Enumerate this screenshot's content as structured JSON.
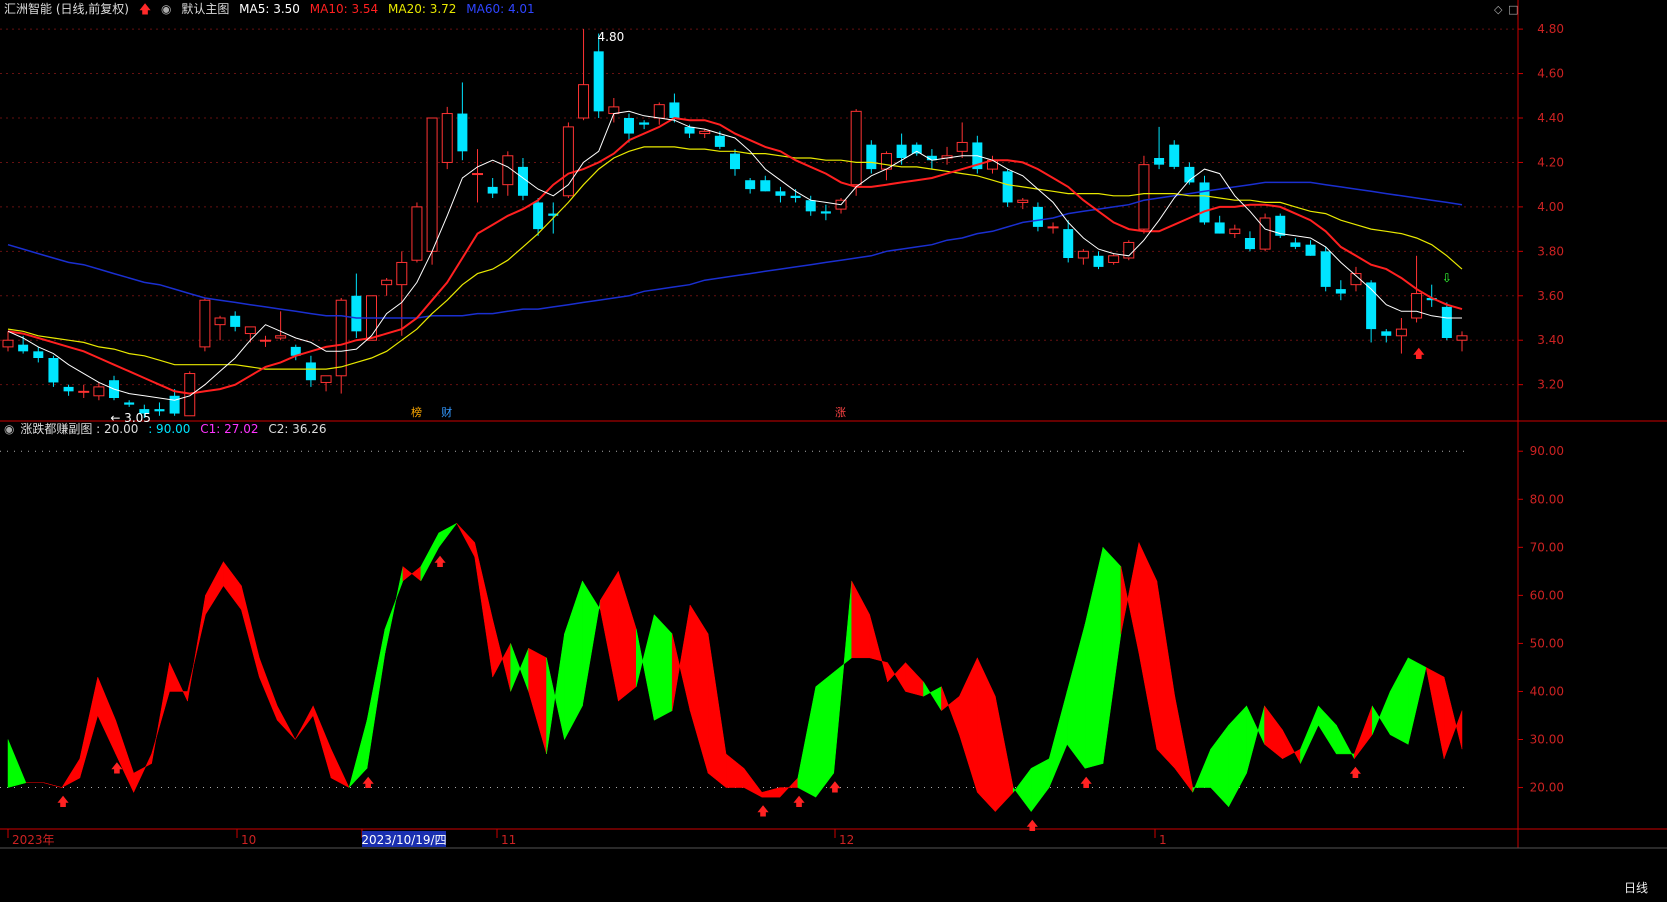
{
  "main_header": {
    "stock": "汇洲智能 (日线,前复权)",
    "template": "默认主图",
    "ma5": "MA5: 3.50",
    "ma10": "MA10: 3.54",
    "ma20": "MA20: 3.72",
    "ma60": "MA60: 4.01"
  },
  "sub_header": {
    "name": "涨跌都赚副图",
    "p1": ": 20.00",
    "p2": ": 90.00",
    "c1": "C1: 27.02",
    "c2": "C2: 36.26"
  },
  "period_tab": "日线",
  "colors": {
    "up": "#ff3333",
    "down": "#00e5ff",
    "ma5": "#ffffff",
    "ma10": "#ff2020",
    "ma20": "#e8e800",
    "ma60": "#1a2fd0",
    "osc_up": "#ff0000",
    "osc_down": "#00ff00",
    "axis": "#cc0000"
  },
  "chart_data": [
    {
      "type": "candlestick",
      "ylim": [
        3.05,
        4.85
      ],
      "y_ticks": [
        "3.20",
        "3.40",
        "3.60",
        "3.80",
        "4.00",
        "4.20",
        "4.40",
        "4.60",
        "4.80"
      ],
      "x_ticks": [
        "2023年",
        "10",
        "2023/10/19/四",
        "11",
        "12",
        "1"
      ],
      "annotations": {
        "high": "4.80",
        "low": "3.05",
        "markers": [
          "榜",
          "财",
          "涨"
        ]
      },
      "ohlc": [
        [
          3.37,
          3.44,
          3.35,
          3.4
        ],
        [
          3.38,
          3.42,
          3.34,
          3.35
        ],
        [
          3.35,
          3.37,
          3.3,
          3.32
        ],
        [
          3.32,
          3.33,
          3.19,
          3.21
        ],
        [
          3.19,
          3.2,
          3.15,
          3.17
        ],
        [
          3.17,
          3.2,
          3.14,
          3.17
        ],
        [
          3.15,
          3.21,
          3.13,
          3.19
        ],
        [
          3.22,
          3.24,
          3.13,
          3.14
        ],
        [
          3.12,
          3.13,
          3.1,
          3.11
        ],
        [
          3.09,
          3.11,
          3.05,
          3.07
        ],
        [
          3.09,
          3.12,
          3.06,
          3.08
        ],
        [
          3.15,
          3.18,
          3.06,
          3.07
        ],
        [
          3.06,
          3.26,
          3.06,
          3.25
        ],
        [
          3.37,
          3.59,
          3.35,
          3.58
        ],
        [
          3.47,
          3.51,
          3.4,
          3.5
        ],
        [
          3.51,
          3.53,
          3.44,
          3.46
        ],
        [
          3.43,
          3.46,
          3.39,
          3.46
        ],
        [
          3.4,
          3.42,
          3.37,
          3.4
        ],
        [
          3.41,
          3.53,
          3.4,
          3.42
        ],
        [
          3.37,
          3.38,
          3.31,
          3.33
        ],
        [
          3.3,
          3.33,
          3.19,
          3.22
        ],
        [
          3.21,
          3.24,
          3.17,
          3.24
        ],
        [
          3.24,
          3.59,
          3.16,
          3.58
        ],
        [
          3.6,
          3.7,
          3.41,
          3.44
        ],
        [
          3.4,
          3.6,
          3.4,
          3.6
        ],
        [
          3.65,
          3.68,
          3.6,
          3.67
        ],
        [
          3.65,
          3.8,
          3.42,
          3.75
        ],
        [
          3.76,
          4.02,
          3.75,
          4.0
        ],
        [
          3.8,
          4.25,
          3.74,
          4.4
        ],
        [
          4.2,
          4.45,
          4.17,
          4.42
        ],
        [
          4.42,
          4.56,
          4.21,
          4.25
        ],
        [
          4.15,
          4.26,
          4.02,
          4.15
        ],
        [
          4.09,
          4.13,
          4.04,
          4.06
        ],
        [
          4.1,
          4.25,
          4.05,
          4.23
        ],
        [
          4.18,
          4.22,
          4.03,
          4.05
        ],
        [
          4.02,
          4.04,
          3.87,
          3.9
        ],
        [
          3.97,
          4.02,
          3.88,
          3.96
        ],
        [
          4.05,
          4.38,
          4.04,
          4.36
        ],
        [
          4.4,
          4.8,
          4.39,
          4.55
        ],
        [
          4.7,
          4.78,
          4.4,
          4.43
        ],
        [
          4.42,
          4.49,
          4.38,
          4.45
        ],
        [
          4.4,
          4.42,
          4.29,
          4.33
        ],
        [
          4.38,
          4.39,
          4.35,
          4.37
        ],
        [
          4.4,
          4.47,
          4.37,
          4.46
        ],
        [
          4.47,
          4.51,
          4.38,
          4.4
        ],
        [
          4.36,
          4.37,
          4.31,
          4.33
        ],
        [
          4.33,
          4.35,
          4.31,
          4.34
        ],
        [
          4.32,
          4.34,
          4.26,
          4.27
        ],
        [
          4.24,
          4.26,
          4.14,
          4.17
        ],
        [
          4.12,
          4.13,
          4.06,
          4.08
        ],
        [
          4.12,
          4.14,
          4.07,
          4.07
        ],
        [
          4.07,
          4.09,
          4.02,
          4.05
        ],
        [
          4.05,
          4.08,
          4.02,
          4.04
        ],
        [
          4.03,
          4.05,
          3.96,
          3.98
        ],
        [
          3.98,
          4.01,
          3.94,
          3.97
        ],
        [
          3.99,
          4.04,
          3.97,
          4.03
        ],
        [
          4.1,
          4.44,
          4.05,
          4.43
        ],
        [
          4.28,
          4.3,
          4.15,
          4.17
        ],
        [
          4.17,
          4.25,
          4.12,
          4.24
        ],
        [
          4.28,
          4.33,
          4.19,
          4.22
        ],
        [
          4.28,
          4.29,
          4.23,
          4.24
        ],
        [
          4.23,
          4.26,
          4.17,
          4.21
        ],
        [
          4.22,
          4.27,
          4.19,
          4.23
        ],
        [
          4.25,
          4.38,
          4.22,
          4.29
        ],
        [
          4.29,
          4.32,
          4.15,
          4.17
        ],
        [
          4.17,
          4.23,
          4.15,
          4.21
        ],
        [
          4.16,
          4.17,
          4.0,
          4.02
        ],
        [
          4.02,
          4.04,
          3.99,
          4.03
        ],
        [
          4.0,
          4.02,
          3.89,
          3.91
        ],
        [
          3.91,
          3.93,
          3.88,
          3.91
        ],
        [
          3.9,
          3.94,
          3.75,
          3.77
        ],
        [
          3.77,
          3.81,
          3.74,
          3.8
        ],
        [
          3.78,
          3.8,
          3.72,
          3.73
        ],
        [
          3.75,
          3.79,
          3.74,
          3.78
        ],
        [
          3.77,
          3.85,
          3.76,
          3.84
        ],
        [
          3.9,
          4.23,
          3.88,
          4.19
        ],
        [
          4.22,
          4.36,
          4.17,
          4.19
        ],
        [
          4.28,
          4.3,
          4.17,
          4.18
        ],
        [
          4.18,
          4.2,
          4.1,
          4.11
        ],
        [
          4.11,
          4.14,
          3.92,
          3.93
        ],
        [
          3.93,
          3.96,
          3.88,
          3.88
        ],
        [
          3.88,
          3.92,
          3.86,
          3.9
        ],
        [
          3.86,
          3.89,
          3.8,
          3.81
        ],
        [
          3.81,
          3.97,
          3.8,
          3.95
        ],
        [
          3.96,
          3.97,
          3.86,
          3.87
        ],
        [
          3.84,
          3.86,
          3.81,
          3.82
        ],
        [
          3.83,
          3.85,
          3.78,
          3.78
        ],
        [
          3.8,
          3.82,
          3.62,
          3.64
        ],
        [
          3.63,
          3.67,
          3.58,
          3.61
        ],
        [
          3.65,
          3.73,
          3.62,
          3.7
        ],
        [
          3.66,
          3.67,
          3.39,
          3.45
        ],
        [
          3.44,
          3.45,
          3.39,
          3.42
        ],
        [
          3.42,
          3.5,
          3.34,
          3.45
        ],
        [
          3.5,
          3.78,
          3.48,
          3.61
        ],
        [
          3.59,
          3.65,
          3.55,
          3.58
        ],
        [
          3.55,
          3.57,
          3.4,
          3.41
        ],
        [
          3.4,
          3.44,
          3.35,
          3.42
        ]
      ],
      "ma5": [
        3.44,
        3.41,
        3.37,
        3.34,
        3.29,
        3.25,
        3.21,
        3.18,
        3.16,
        3.15,
        3.14,
        3.13,
        3.15,
        3.2,
        3.26,
        3.32,
        3.4,
        3.47,
        3.44,
        3.41,
        3.39,
        3.35,
        3.35,
        3.36,
        3.42,
        3.52,
        3.57,
        3.66,
        3.8,
        3.96,
        4.13,
        4.18,
        4.21,
        4.18,
        4.13,
        4.08,
        4.05,
        4.1,
        4.2,
        4.25,
        4.42,
        4.43,
        4.41,
        4.4,
        4.39,
        4.36,
        4.35,
        4.33,
        4.31,
        4.25,
        4.17,
        4.12,
        4.07,
        4.03,
        4.02,
        4.01,
        4.09,
        4.14,
        4.17,
        4.21,
        4.25,
        4.21,
        4.22,
        4.23,
        4.23,
        4.21,
        4.17,
        4.14,
        4.08,
        4.02,
        3.93,
        3.86,
        3.81,
        3.79,
        3.78,
        3.85,
        3.94,
        4.04,
        4.12,
        4.17,
        4.15,
        4.05,
        3.98,
        3.9,
        3.88,
        3.87,
        3.86,
        3.82,
        3.75,
        3.69,
        3.63,
        3.56,
        3.53,
        3.53,
        3.51,
        3.5,
        3.5
      ],
      "ma10": [
        3.44,
        3.43,
        3.41,
        3.39,
        3.37,
        3.35,
        3.32,
        3.29,
        3.26,
        3.23,
        3.2,
        3.17,
        3.16,
        3.17,
        3.18,
        3.2,
        3.24,
        3.28,
        3.3,
        3.33,
        3.35,
        3.37,
        3.38,
        3.4,
        3.41,
        3.43,
        3.45,
        3.5,
        3.58,
        3.66,
        3.77,
        3.88,
        3.92,
        3.96,
        3.99,
        4.03,
        4.1,
        4.15,
        4.17,
        4.2,
        4.24,
        4.3,
        4.33,
        4.36,
        4.4,
        4.39,
        4.39,
        4.37,
        4.33,
        4.3,
        4.27,
        4.25,
        4.21,
        4.18,
        4.15,
        4.11,
        4.09,
        4.09,
        4.1,
        4.11,
        4.12,
        4.13,
        4.15,
        4.17,
        4.19,
        4.21,
        4.21,
        4.2,
        4.17,
        4.13,
        4.09,
        4.03,
        3.98,
        3.93,
        3.9,
        3.89,
        3.89,
        3.92,
        3.95,
        3.98,
        4.0,
        4.0,
        4.01,
        4.01,
        4.0,
        3.97,
        3.94,
        3.89,
        3.82,
        3.78,
        3.74,
        3.72,
        3.68,
        3.63,
        3.59,
        3.56,
        3.54
      ],
      "ma20": [
        3.45,
        3.44,
        3.42,
        3.41,
        3.4,
        3.39,
        3.37,
        3.36,
        3.34,
        3.33,
        3.31,
        3.29,
        3.29,
        3.29,
        3.29,
        3.29,
        3.28,
        3.27,
        3.27,
        3.27,
        3.27,
        3.27,
        3.28,
        3.3,
        3.32,
        3.35,
        3.4,
        3.45,
        3.52,
        3.58,
        3.65,
        3.7,
        3.72,
        3.76,
        3.82,
        3.88,
        3.95,
        4.02,
        4.1,
        4.17,
        4.22,
        4.25,
        4.27,
        4.27,
        4.27,
        4.26,
        4.26,
        4.25,
        4.25,
        4.24,
        4.24,
        4.23,
        4.22,
        4.22,
        4.21,
        4.21,
        4.2,
        4.2,
        4.19,
        4.18,
        4.18,
        4.17,
        4.16,
        4.15,
        4.14,
        4.12,
        4.1,
        4.09,
        4.08,
        4.07,
        4.06,
        4.06,
        4.06,
        4.05,
        4.05,
        4.06,
        4.06,
        4.06,
        4.05,
        4.05,
        4.04,
        4.03,
        4.03,
        4.02,
        4.02,
        4.0,
        3.98,
        3.97,
        3.94,
        3.92,
        3.9,
        3.89,
        3.88,
        3.86,
        3.83,
        3.78,
        3.72
      ],
      "ma60": [
        3.83,
        3.81,
        3.79,
        3.77,
        3.75,
        3.74,
        3.72,
        3.7,
        3.68,
        3.66,
        3.65,
        3.63,
        3.61,
        3.59,
        3.58,
        3.57,
        3.56,
        3.55,
        3.54,
        3.53,
        3.52,
        3.51,
        3.51,
        3.5,
        3.5,
        3.5,
        3.5,
        3.5,
        3.51,
        3.51,
        3.51,
        3.52,
        3.52,
        3.53,
        3.54,
        3.54,
        3.55,
        3.56,
        3.57,
        3.58,
        3.59,
        3.6,
        3.62,
        3.63,
        3.64,
        3.65,
        3.67,
        3.68,
        3.69,
        3.7,
        3.71,
        3.72,
        3.73,
        3.74,
        3.75,
        3.76,
        3.77,
        3.78,
        3.8,
        3.81,
        3.82,
        3.83,
        3.85,
        3.86,
        3.88,
        3.89,
        3.91,
        3.93,
        3.94,
        3.95,
        3.97,
        3.98,
        3.99,
        4.0,
        4.01,
        4.03,
        4.04,
        4.05,
        4.06,
        4.07,
        4.08,
        4.09,
        4.1,
        4.11,
        4.11,
        4.11,
        4.11,
        4.1,
        4.09,
        4.08,
        4.07,
        4.06,
        4.05,
        4.04,
        4.03,
        4.02,
        4.01
      ]
    },
    {
      "type": "area",
      "ylim": [
        12,
        94
      ],
      "y_ticks": [
        "20.00",
        "30.00",
        "40.00",
        "50.00",
        "60.00",
        "70.00",
        "80.00",
        "90.00"
      ],
      "reference_lines": [
        20,
        90
      ],
      "c1": [
        20,
        21,
        21,
        20,
        26,
        43,
        34,
        23,
        25,
        46,
        38,
        60,
        67,
        62,
        47,
        37,
        30,
        37,
        28,
        20,
        24,
        48,
        66,
        63,
        70,
        75,
        71,
        55,
        40,
        49,
        47,
        30,
        37,
        59,
        65,
        53,
        34,
        36,
        58,
        52,
        27,
        24,
        19,
        20,
        20,
        18,
        23,
        63,
        56,
        42,
        46,
        42,
        36,
        39,
        47,
        39,
        20,
        15,
        20,
        29,
        24,
        25,
        52,
        71,
        63,
        39,
        20,
        20,
        16,
        23,
        37,
        32,
        25,
        33,
        27,
        27,
        37,
        31,
        29,
        45,
        43,
        28
      ],
      "c2": [
        30,
        21,
        21,
        20,
        22,
        35,
        27,
        19,
        27,
        40,
        40,
        56,
        62,
        57,
        43,
        34,
        30,
        35,
        22,
        20,
        34,
        53,
        63,
        66,
        73,
        75,
        68,
        43,
        50,
        40,
        27,
        52,
        63,
        57,
        38,
        41,
        56,
        52,
        36,
        23,
        20,
        20,
        18,
        18,
        22,
        41,
        44,
        47,
        47,
        46,
        40,
        39,
        41,
        31,
        19,
        15,
        19,
        24,
        26,
        40,
        54,
        70,
        66,
        48,
        28,
        24,
        19,
        28,
        33,
        37,
        29,
        26,
        28,
        37,
        33,
        26,
        31,
        40,
        47,
        45,
        26,
        36
      ]
    }
  ]
}
